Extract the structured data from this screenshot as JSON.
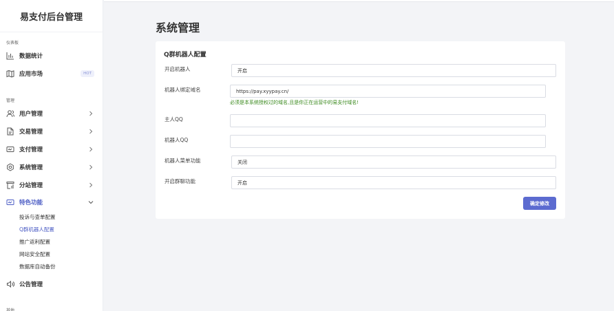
{
  "sidebar": {
    "brand": "易支付后台管理",
    "sections": {
      "dashboard": "仪表板",
      "manage": "管理",
      "other": "其他"
    },
    "items": {
      "stats": "数据统计",
      "market": "应用市场",
      "market_badge": "HOT",
      "users": "用户管理",
      "trades": "交易管理",
      "pay": "支付管理",
      "system": "系统管理",
      "substation": "分站管理",
      "features": "特色功能",
      "notice": "公告管理"
    },
    "sub_items": {
      "complaint": "投诉与查单配置",
      "qbot": "Q群机器人配置",
      "promo": "推广返利配置",
      "security": "网站安全配置",
      "backup": "数据库自动备份"
    }
  },
  "main": {
    "page_title": "系统管理",
    "card_title": "Q群机器人配置",
    "fields": {
      "enable_bot": {
        "label": "开启机器人",
        "value": "开启"
      },
      "bot_domain": {
        "label": "机器人绑定域名",
        "value": "https://pay.xyypay.cn/",
        "hint": "必须是本系统授权过的域名,且是你正在运营中的易支付域名!"
      },
      "owner_qq": {
        "label": "主人QQ",
        "value": ""
      },
      "bot_qq": {
        "label": "机器人QQ",
        "value": ""
      },
      "bot_menu": {
        "label": "机器人菜单功能",
        "value": "关闭"
      },
      "group_chat": {
        "label": "开启群聊功能",
        "value": "开启"
      }
    },
    "submit_label": "确定修改"
  },
  "colors": {
    "accent": "#5c6bd0",
    "active_text": "#4b5cc4",
    "hint": "#3b8a1e"
  }
}
